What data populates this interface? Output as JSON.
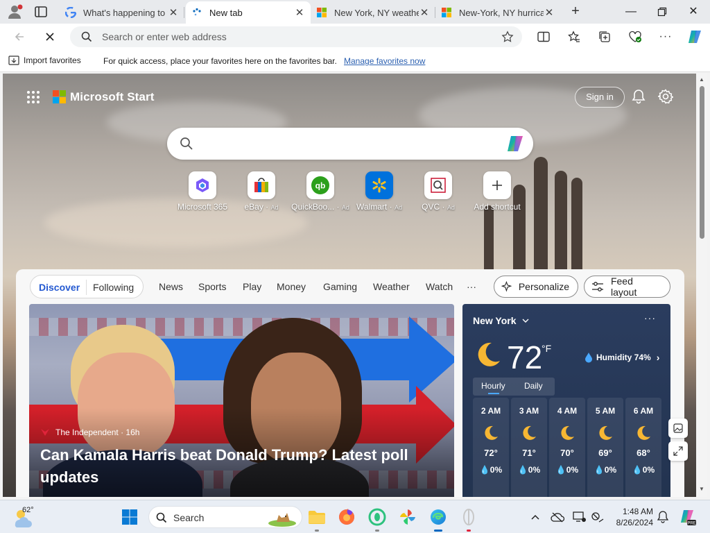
{
  "tabs": [
    {
      "title": "What's happening to t",
      "icon": "google-icon",
      "active": false
    },
    {
      "title": "New tab",
      "icon": "loading-icon",
      "active": true
    },
    {
      "title": "New York, NY weather",
      "icon": "msn-icon",
      "active": false
    },
    {
      "title": "New-York, NY hurrican",
      "icon": "msn-icon",
      "active": false
    }
  ],
  "address": {
    "placeholder": "Search or enter web address",
    "value": ""
  },
  "favorites_bar": {
    "import_label": "Import favorites",
    "message": "For quick access, place your favorites here on the favorites bar.",
    "manage_link": "Manage favorites now"
  },
  "start": {
    "brand": "Microsoft Start",
    "signin": "Sign in",
    "search_placeholder": ""
  },
  "shortcuts": [
    {
      "label": "Microsoft 365",
      "ad": ""
    },
    {
      "label": "eBay",
      "ad": "Ad"
    },
    {
      "label": "QuickBoo...",
      "ad": "Ad"
    },
    {
      "label": "Walmart",
      "ad": "Ad"
    },
    {
      "label": "QVC",
      "ad": "Ad"
    },
    {
      "label": "Add shortcut",
      "ad": ""
    }
  ],
  "feed_nav": {
    "discover": "Discover",
    "following": "Following",
    "items": [
      "News",
      "Sports",
      "Play",
      "Money",
      "Gaming",
      "Weather",
      "Watch"
    ],
    "more": "···",
    "personalize": "Personalize",
    "feed_layout": "Feed layout"
  },
  "hero": {
    "source": "The Independent · 16h",
    "headline": "Can Kamala Harris beat Donald Trump? Latest poll updates"
  },
  "weather": {
    "city": "New York",
    "more": "···",
    "temp": "72",
    "unit": "°F",
    "humidity": "Humidity 74%",
    "tabs": [
      "Hourly",
      "Daily"
    ],
    "hours": [
      {
        "time": "2 AM",
        "temp": "72°",
        "precip": "0%"
      },
      {
        "time": "3 AM",
        "temp": "71°",
        "precip": "0%"
      },
      {
        "time": "4 AM",
        "temp": "70°",
        "precip": "0%"
      },
      {
        "time": "5 AM",
        "temp": "69°",
        "precip": "0%"
      },
      {
        "time": "6 AM",
        "temp": "68°",
        "precip": "0%"
      }
    ]
  },
  "taskbar": {
    "weather_temp": "62°",
    "search_label": "Search",
    "time": "1:48 AM",
    "date": "8/26/2024"
  },
  "colors": {
    "accent": "#2459d1",
    "weather_bg": "#22334f",
    "link": "#2a5fb0"
  }
}
